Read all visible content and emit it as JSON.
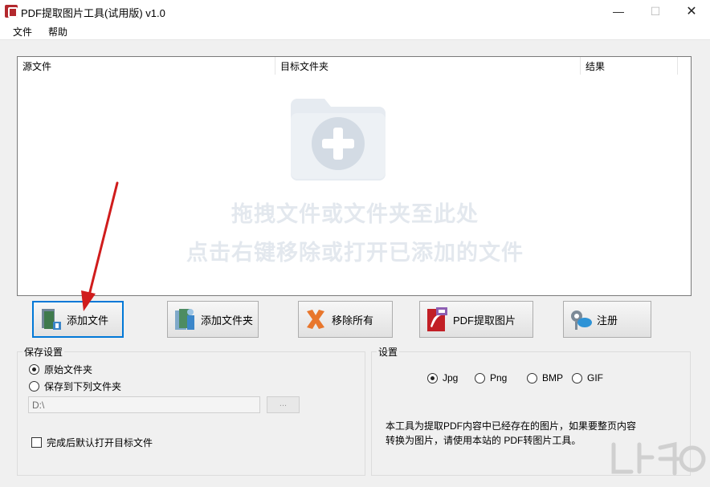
{
  "window": {
    "title": "PDF提取图片工具(试用版) v1.0",
    "minimize": "—",
    "maximize": "☐",
    "close": "✕"
  },
  "menu": {
    "file": "文件",
    "help": "帮助"
  },
  "list": {
    "columns": [
      "源文件",
      "目标文件夹",
      "结果"
    ],
    "drop_hint_line1": "拖拽文件或文件夹至此处",
    "drop_hint_line2": "点击右键移除或打开已添加的文件"
  },
  "toolbar": {
    "add_file": "添加文件",
    "add_folder": "添加文件夹",
    "remove_all": "移除所有",
    "extract": "PDF提取图片",
    "register": "注册"
  },
  "save_settings": {
    "legend": "保存设置",
    "option_original": "原始文件夹",
    "option_custom": "保存到下列文件夹",
    "selected": "原始文件夹",
    "path_value": "D:\\",
    "browse_label": "...",
    "open_after": "完成后默认打开目标文件",
    "open_after_checked": false
  },
  "settings": {
    "legend": "设置",
    "formats": [
      "Jpg",
      "Png",
      "BMP",
      "GIF"
    ],
    "selected_format": "Jpg",
    "note_line1": "本工具为提取PDF内容中已经存在的图片，如果要整页内容",
    "note_line2": "转换为图片，请使用本站的 PDF转图片工具。"
  },
  "colors": {
    "focus_border": "#0078d7",
    "arrow": "#d01c1c",
    "hint_text": "#e3e8ee",
    "pdf_red": "#b3282d"
  }
}
